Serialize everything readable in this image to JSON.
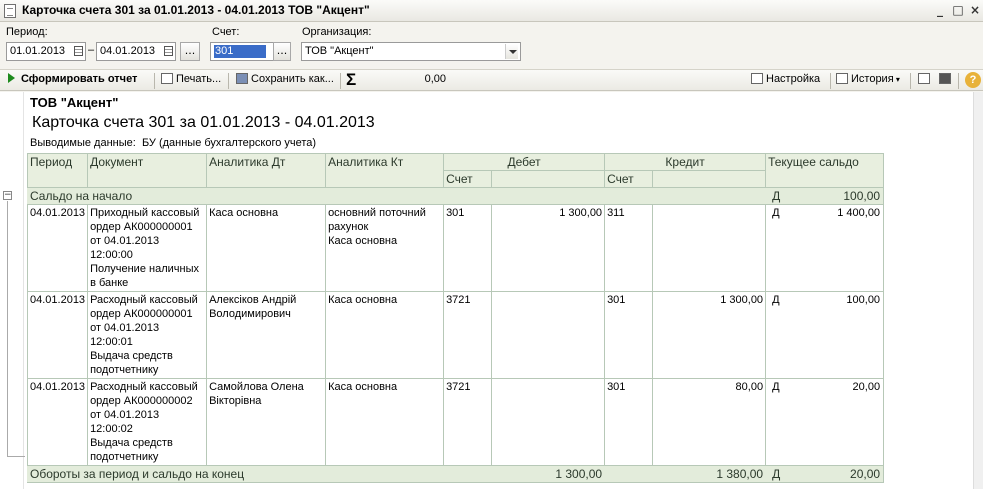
{
  "window": {
    "title": "Карточка счета 301 за 01.01.2013 - 04.01.2013 ТОВ \"Акцент\"",
    "minimize_glyph": "_",
    "maximize_glyph": "□",
    "close_glyph": "×"
  },
  "filters": {
    "period_label": "Период:",
    "period_from": "01.01.2013",
    "period_to": "04.01.2013",
    "period_dash": "–",
    "period_button": "...",
    "account_label": "Счет:",
    "account_value": "301",
    "account_button": "...",
    "org_label": "Организация:",
    "org_value": "ТОВ \"Акцент\""
  },
  "toolbar": {
    "generate": "Сформировать отчет",
    "print": "Печать...",
    "save": "Сохранить как...",
    "sum_symbol": "Σ",
    "sum_value": "0,00",
    "settings": "Настройка",
    "history": "История",
    "help": "?"
  },
  "report": {
    "org": "ТОВ \"Акцент\"",
    "title": "Карточка счета 301 за 01.01.2013 - 04.01.2013",
    "output_label": "Выводимые данные:",
    "output_value": "БУ (данные бухгалтерского учета)",
    "headers": {
      "period": "Период",
      "document": "Документ",
      "analytics_dt": "Аналитика Дт",
      "analytics_kt": "Аналитика Кт",
      "debit": "Дебет",
      "credit": "Кредит",
      "balance": "Текущее сальдо",
      "account": "Счет"
    },
    "opening": {
      "label": "Сальдо на начало",
      "side": "Д",
      "amount": "100,00"
    },
    "rows": [
      {
        "date": "04.01.2013",
        "doc": [
          "Приходный кассовый",
          "ордер АК000000001",
          "от 04.01.2013",
          "12:00:00",
          "Получение наличных",
          "в банке"
        ],
        "dt": [
          "Каса основна"
        ],
        "kt": [
          "основний поточний",
          "рахунок",
          "Каса основна"
        ],
        "dt_account": "301",
        "dt_amount": "1 300,00",
        "kt_account": "311",
        "kt_amount": "",
        "bal_side": "Д",
        "bal_amount": "1 400,00"
      },
      {
        "date": "04.01.2013",
        "doc": [
          "Расходный кассовый",
          "ордер АК000000001",
          "от 04.01.2013",
          "12:00:01",
          "Выдача средств",
          "подотчетнику"
        ],
        "dt": [
          "Алексіков Андрій",
          "Володимирович"
        ],
        "kt": [
          "Каса основна"
        ],
        "dt_account": "3721",
        "dt_amount": "",
        "kt_account": "301",
        "kt_amount": "1 300,00",
        "bal_side": "Д",
        "bal_amount": "100,00"
      },
      {
        "date": "04.01.2013",
        "doc": [
          "Расходный кассовый",
          "ордер АК000000002",
          "от 04.01.2013",
          "12:00:02",
          "Выдача средств",
          "подотчетнику"
        ],
        "dt": [
          "Самойлова Олена",
          "Вікторівна"
        ],
        "kt": [
          "Каса основна"
        ],
        "dt_account": "3721",
        "dt_amount": "",
        "kt_account": "301",
        "kt_amount": "80,00",
        "bal_side": "Д",
        "bal_amount": "20,00"
      }
    ],
    "totals": {
      "label": "Обороты за период и сальдо на конец",
      "debit": "1 300,00",
      "credit": "1 380,00",
      "side": "Д",
      "amount": "20,00"
    },
    "tree_toggle": "−"
  }
}
